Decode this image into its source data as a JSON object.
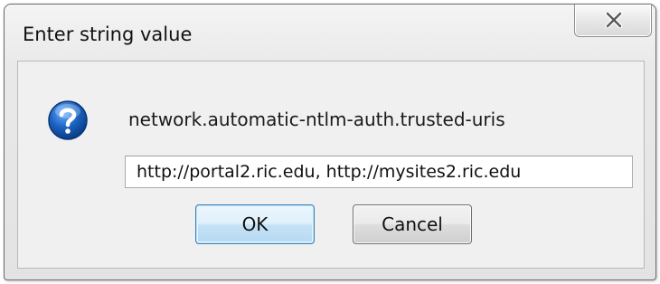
{
  "dialog": {
    "title": "Enter string value",
    "close_icon": "close-x-icon",
    "question_icon": "question-mark-icon",
    "message": "network.automatic-ntlm-auth.trusted-uris",
    "input_value": "http://portal2.ric.edu, http://mysites2.ric.edu",
    "ok_label": "OK",
    "cancel_label": "Cancel"
  },
  "colors": {
    "icon_blue": "#1b63c2",
    "ok_border": "#3c7fb1",
    "frame_border": "#6c6c6c"
  }
}
